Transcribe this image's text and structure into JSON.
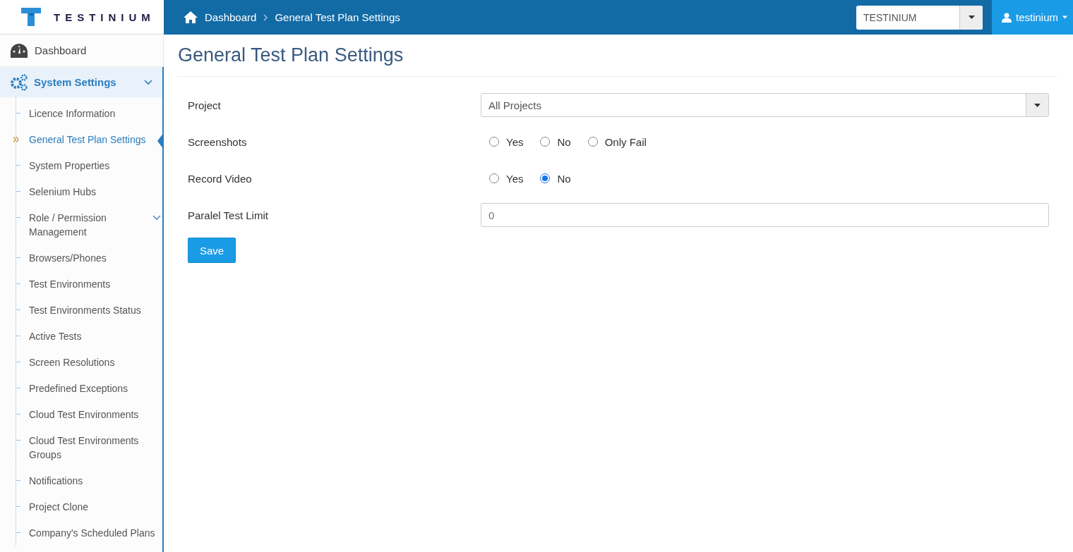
{
  "logo": {
    "text": "TESTINIUM"
  },
  "breadcrumb": [
    {
      "label": "Dashboard",
      "kind": "home"
    },
    {
      "label": "General Test Plan Settings",
      "kind": "current"
    }
  ],
  "company_select": {
    "value": "TESTINIUM"
  },
  "user_menu": {
    "label": "testinium"
  },
  "sidebar": {
    "dashboard": {
      "label": "Dashboard"
    },
    "section": {
      "label": "System Settings",
      "expanded": true,
      "children": [
        {
          "label": "Licence Information",
          "selected": false,
          "kind": "link"
        },
        {
          "label": "General Test Plan Settings",
          "selected": true,
          "kind": "link"
        },
        {
          "label": "System Properties",
          "selected": false,
          "kind": "link"
        },
        {
          "label": "Selenium Hubs",
          "selected": false,
          "kind": "link"
        },
        {
          "label": "Role / Permission Management",
          "selected": false,
          "kind": "group"
        },
        {
          "label": "Browsers/Phones",
          "selected": false,
          "kind": "link"
        },
        {
          "label": "Test Environments",
          "selected": false,
          "kind": "link"
        },
        {
          "label": "Test Environments Status",
          "selected": false,
          "kind": "link"
        },
        {
          "label": "Active Tests",
          "selected": false,
          "kind": "link"
        },
        {
          "label": "Screen Resolutions",
          "selected": false,
          "kind": "link"
        },
        {
          "label": "Predefined Exceptions",
          "selected": false,
          "kind": "link"
        },
        {
          "label": "Cloud Test Environments",
          "selected": false,
          "kind": "link"
        },
        {
          "label": "Cloud Test Environments Groups",
          "selected": false,
          "kind": "link"
        },
        {
          "label": "Notifications",
          "selected": false,
          "kind": "link"
        },
        {
          "label": "Project Clone",
          "selected": false,
          "kind": "link"
        },
        {
          "label": "Company's Scheduled Plans",
          "selected": false,
          "kind": "link"
        }
      ]
    }
  },
  "page": {
    "title": "General Test Plan Settings",
    "fields": [
      {
        "label": "Project",
        "kind": "select",
        "value": "All Projects"
      },
      {
        "label": "Screenshots",
        "kind": "radio",
        "options": [
          {
            "label": "Yes",
            "selected": false
          },
          {
            "label": "No",
            "selected": false
          },
          {
            "label": "Only Fail",
            "selected": false
          }
        ]
      },
      {
        "label": "Record Video",
        "kind": "radio",
        "options": [
          {
            "label": "Yes",
            "selected": false
          },
          {
            "label": "No",
            "selected": true
          }
        ]
      },
      {
        "label": "Paralel Test Limit",
        "kind": "input",
        "value": "0"
      }
    ],
    "save_button": {
      "label": "Save"
    }
  }
}
